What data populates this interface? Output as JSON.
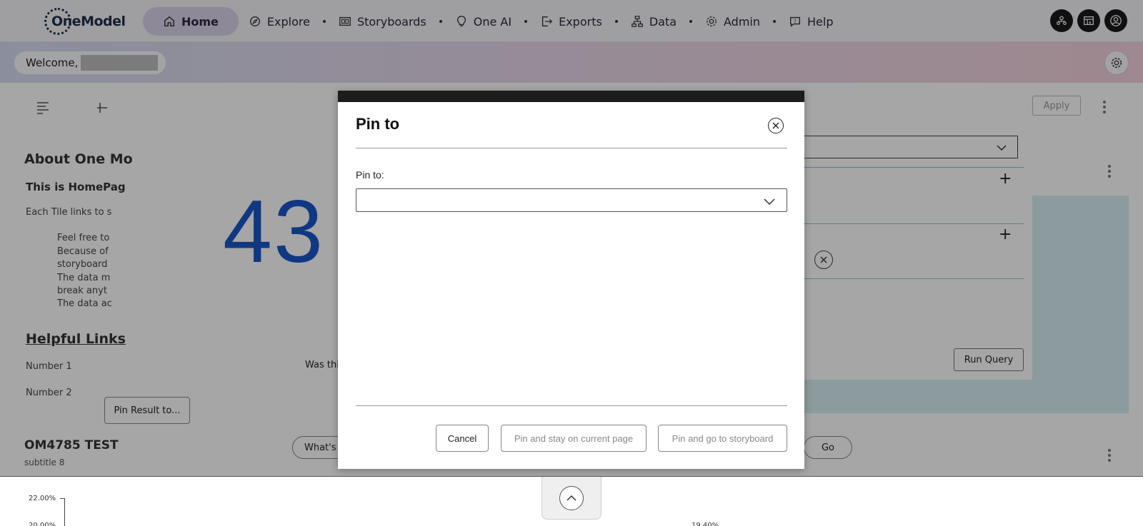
{
  "nav": {
    "logo_text": "OneModel",
    "items": [
      {
        "label": "Home",
        "icon": "home-icon",
        "active": true
      },
      {
        "label": "Explore",
        "icon": "compass-icon"
      },
      {
        "label": "Storyboards",
        "icon": "storyboard-icon"
      },
      {
        "label": "One AI",
        "icon": "lightbulb-icon"
      },
      {
        "label": "Exports",
        "icon": "export-icon"
      },
      {
        "label": "Data",
        "icon": "data-icon"
      },
      {
        "label": "Admin",
        "icon": "gear-icon"
      },
      {
        "label": "Help",
        "icon": "help-icon"
      }
    ]
  },
  "welcome": {
    "label": "Welcome,"
  },
  "background": {
    "tile_title": "About One Mo",
    "tile_subtitle": "This is HomePag",
    "tile_text": "Each Tile links to s",
    "bullets": [
      "Feel free to",
      "Because of",
      "storyboard",
      "The data m",
      "break anyt",
      "The data ac"
    ],
    "big_number": "43",
    "helpful_links": "Helpful Links",
    "links": [
      "Number 1",
      "Number 2"
    ],
    "pin_result_button": "Pin Result to...",
    "was_this": "Was this",
    "apply_button": "Apply",
    "run_query_button": "Run Query",
    "whats_pill": "What's c",
    "go_pill": "Go",
    "om_title": "OM4785 TEST",
    "om_subtitle": "subtitle 8",
    "axis_tick_1": "22.00%",
    "axis_tick_2": "20.00%",
    "axis_tick_3": "19.40%"
  },
  "modal": {
    "title": "Pin to",
    "field_label": "Pin to:",
    "select_value": "",
    "cancel_button": "Cancel",
    "stay_button": "Pin and stay on current page",
    "go_button": "Pin and go to storyboard"
  },
  "colors": {
    "accent_blue": "#1a56c8",
    "nav_active": "#d9d3ea",
    "modal_bar": "#1c1c1c"
  }
}
